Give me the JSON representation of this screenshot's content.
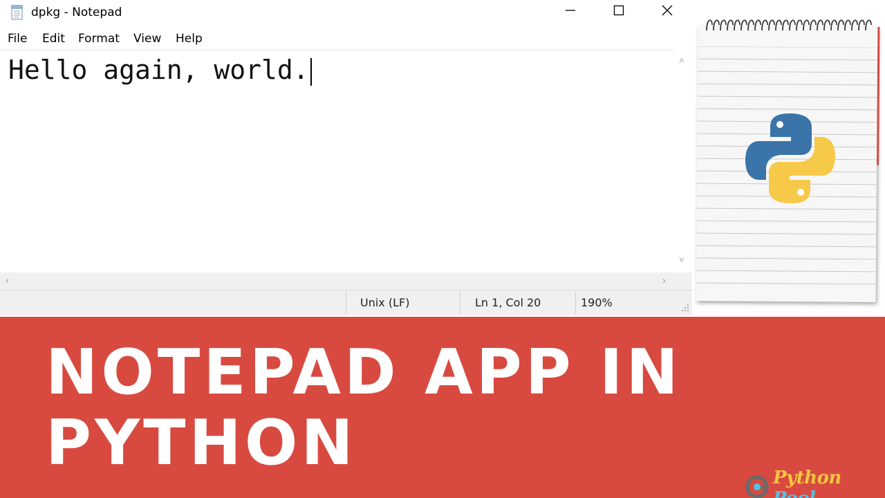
{
  "window": {
    "title": "dpkg - Notepad",
    "app_icon": "notepad-icon",
    "controls": [
      "minimize-icon",
      "maximize-icon",
      "close-icon"
    ]
  },
  "menu": {
    "items": [
      "File",
      "Edit",
      "Format",
      "View",
      "Help"
    ]
  },
  "editor": {
    "text": "Hello again, world."
  },
  "statusbar": {
    "line_ending": "Unix (LF)",
    "position": "Ln 1, Col 20",
    "zoom": "190%"
  },
  "banner": {
    "title_line1": "NOTEPAD APP IN",
    "title_line2": "PYTHON",
    "background_color": "#d84a40",
    "brand_part1": "Python",
    "brand_part2": "Pool",
    "brand_icon": "python-pool-logo-icon"
  },
  "illustration": {
    "pad_icon": "spiral-notepad-icon",
    "logo_icon": "python-logo-icon",
    "python_blue": "#3a74a8",
    "python_yellow": "#f7c948"
  }
}
